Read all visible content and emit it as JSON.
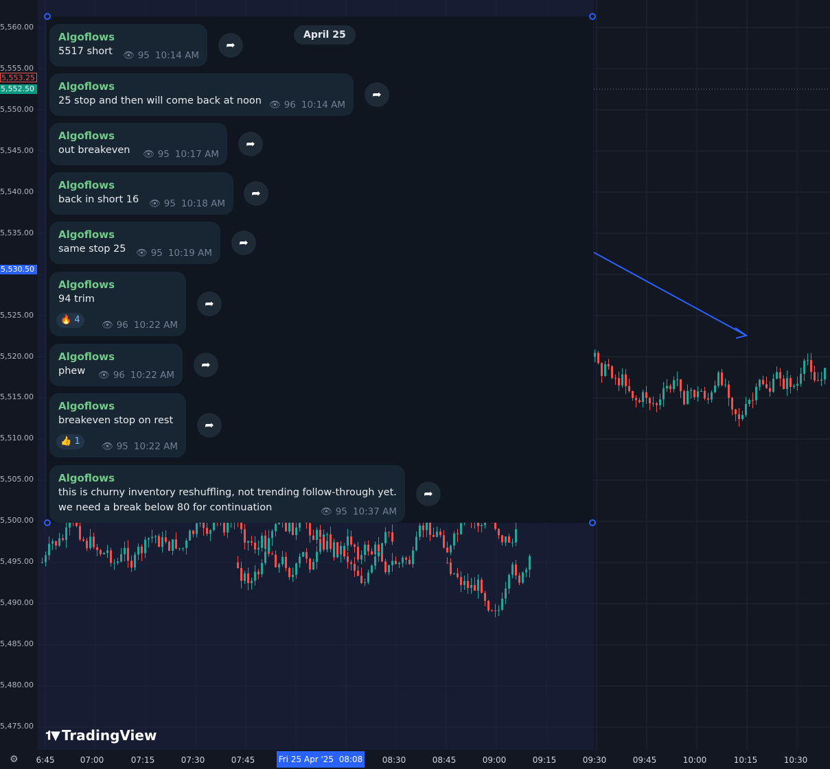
{
  "price_axis": {
    "labels": [
      "5,560.00",
      "5,555.00",
      "5,550.00",
      "5,545.00",
      "5,540.00",
      "5,535.00",
      "5,525.00",
      "5,520.00",
      "5,515.00",
      "5,510.00",
      "5,505.00",
      "5,500.00",
      "5,495.00",
      "5,490.00",
      "5,485.00",
      "5,480.00",
      "5,475.00"
    ],
    "badge_red": "5,553.25",
    "badge_green": "5,552.50",
    "badge_blue": "5,530.50"
  },
  "time_axis": {
    "labels": [
      "6:45",
      "07:00",
      "07:15",
      "07:30",
      "07:45",
      "08:30",
      "08:45",
      "09:00",
      "09:15",
      "09:30",
      "09:45",
      "10:00",
      "10:15",
      "10:30"
    ],
    "cursor_date": "Fri 25 Apr '25",
    "cursor_time": "08:08"
  },
  "branding": {
    "logo_text": "TradingView"
  },
  "colors": {
    "up": "#26a69a",
    "down": "#ef5350",
    "accent": "#2962ff",
    "sender": "#72c98a"
  },
  "chat": {
    "date_chip": "April 25",
    "messages": [
      {
        "sender": "Algoflows",
        "text": "5517 short",
        "views": "95",
        "time": "10:14 AM"
      },
      {
        "sender": "Algoflows",
        "text": "25 stop and then will come back at noon",
        "views": "96",
        "time": "10:14 AM"
      },
      {
        "sender": "Algoflows",
        "text": "out breakeven",
        "views": "95",
        "time": "10:17 AM"
      },
      {
        "sender": "Algoflows",
        "text": "back in short 16",
        "views": "95",
        "time": "10:18 AM"
      },
      {
        "sender": "Algoflows",
        "text": "same stop 25",
        "views": "95",
        "time": "10:19 AM"
      },
      {
        "sender": "Algoflows",
        "text": "94 trim",
        "views": "96",
        "time": "10:22 AM",
        "reaction": {
          "emoji": "🔥",
          "count": "4"
        }
      },
      {
        "sender": "Algoflows",
        "text": "phew",
        "views": "96",
        "time": "10:22 AM"
      },
      {
        "sender": "Algoflows",
        "text": "breakeven stop on rest",
        "views": "95",
        "time": "10:22 AM",
        "reaction": {
          "emoji": "👍",
          "count": "1"
        }
      },
      {
        "sender": "Algoflows",
        "text": "this is churny inventory reshuffling, not trending follow-through yet.\nwe need a break below 80 for continuation",
        "views": "95",
        "time": "10:37 AM"
      }
    ]
  }
}
